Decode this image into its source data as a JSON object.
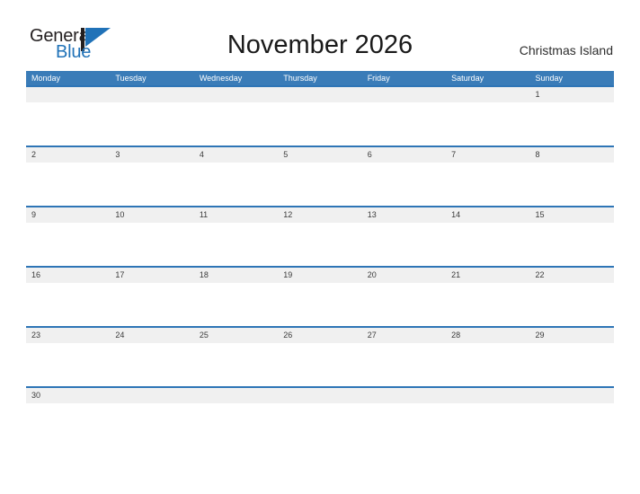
{
  "brand": {
    "name_top": "General",
    "name_bottom": "Blue",
    "flag_icon": "blue-flag-icon",
    "color_dark": "#231f20",
    "color_blue": "#2072b8"
  },
  "header": {
    "title": "November 2026",
    "location": "Christmas Island"
  },
  "colors": {
    "header_blue": "#3a7cb8",
    "row_divider_blue": "#2e75b6",
    "date_strip_gray": "#f0f0f0",
    "date_text": "#3a3a3a",
    "title_text": "#1a1a1a"
  },
  "calendar": {
    "month": "November",
    "year": "2026",
    "week_start": "Monday",
    "weekdays": [
      "Monday",
      "Tuesday",
      "Wednesday",
      "Thursday",
      "Friday",
      "Saturday",
      "Sunday"
    ],
    "weeks": [
      [
        "",
        "",
        "",
        "",
        "",
        "",
        "1"
      ],
      [
        "2",
        "3",
        "4",
        "5",
        "6",
        "7",
        "8"
      ],
      [
        "9",
        "10",
        "11",
        "12",
        "13",
        "14",
        "15"
      ],
      [
        "16",
        "17",
        "18",
        "19",
        "20",
        "21",
        "22"
      ],
      [
        "23",
        "24",
        "25",
        "26",
        "27",
        "28",
        "29"
      ],
      [
        "30",
        "",
        "",
        "",
        "",
        "",
        ""
      ]
    ]
  }
}
